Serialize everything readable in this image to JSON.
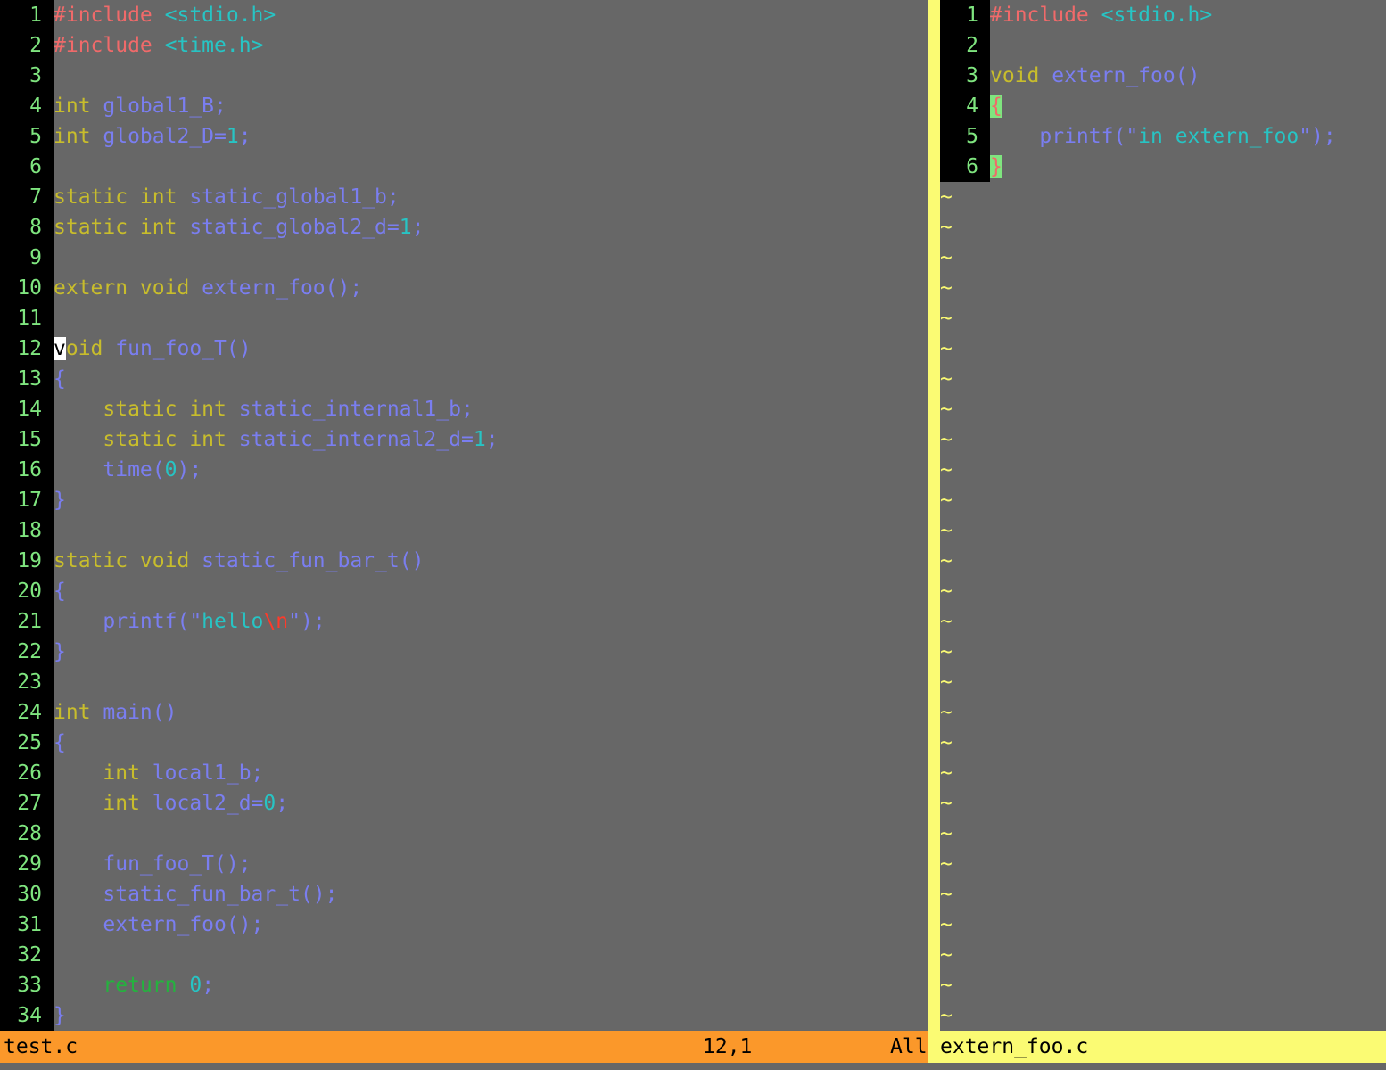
{
  "left_window": {
    "filename": "test.c",
    "position": "12,1",
    "scroll": "All",
    "lines": [
      {
        "n": "1",
        "tokens": [
          [
            "pre",
            "#include "
          ],
          [
            "inc",
            "<stdio.h>"
          ]
        ]
      },
      {
        "n": "2",
        "tokens": [
          [
            "pre",
            "#include "
          ],
          [
            "inc",
            "<time.h>"
          ]
        ]
      },
      {
        "n": "3",
        "tokens": []
      },
      {
        "n": "4",
        "tokens": [
          [
            "kw",
            "int "
          ],
          [
            "id",
            "global1_B;"
          ]
        ]
      },
      {
        "n": "5",
        "tokens": [
          [
            "kw",
            "int "
          ],
          [
            "id",
            "global2_D="
          ],
          [
            "num",
            "1"
          ],
          [
            "id",
            ";"
          ]
        ]
      },
      {
        "n": "6",
        "tokens": []
      },
      {
        "n": "7",
        "tokens": [
          [
            "kw",
            "static int "
          ],
          [
            "id",
            "static_global1_b;"
          ]
        ]
      },
      {
        "n": "8",
        "tokens": [
          [
            "kw",
            "static int "
          ],
          [
            "id",
            "static_global2_d="
          ],
          [
            "num",
            "1"
          ],
          [
            "id",
            ";"
          ]
        ]
      },
      {
        "n": "9",
        "tokens": []
      },
      {
        "n": "10",
        "tokens": [
          [
            "kw",
            "extern void "
          ],
          [
            "id",
            "extern_foo();"
          ]
        ]
      },
      {
        "n": "11",
        "tokens": []
      },
      {
        "n": "12",
        "tokens": [
          [
            "cursor",
            "v"
          ],
          [
            "kw",
            "oid "
          ],
          [
            "id",
            "fun_foo_T()"
          ]
        ]
      },
      {
        "n": "13",
        "tokens": [
          [
            "id",
            "{"
          ]
        ]
      },
      {
        "n": "14",
        "tokens": [
          [
            "kw",
            "    static int "
          ],
          [
            "id",
            "static_internal1_b;"
          ]
        ]
      },
      {
        "n": "15",
        "tokens": [
          [
            "kw",
            "    static int "
          ],
          [
            "id",
            "static_internal2_d="
          ],
          [
            "num",
            "1"
          ],
          [
            "id",
            ";"
          ]
        ]
      },
      {
        "n": "16",
        "tokens": [
          [
            "id",
            "    time("
          ],
          [
            "num",
            "0"
          ],
          [
            "id",
            ");"
          ]
        ]
      },
      {
        "n": "17",
        "tokens": [
          [
            "id",
            "}"
          ]
        ]
      },
      {
        "n": "18",
        "tokens": []
      },
      {
        "n": "19",
        "tokens": [
          [
            "kw",
            "static void "
          ],
          [
            "id",
            "static_fun_bar_t()"
          ]
        ]
      },
      {
        "n": "20",
        "tokens": [
          [
            "id",
            "{"
          ]
        ]
      },
      {
        "n": "21",
        "tokens": [
          [
            "id",
            "    printf(\""
          ],
          [
            "str",
            "hello"
          ],
          [
            "esc",
            "\\n"
          ],
          [
            "id",
            "\");"
          ]
        ]
      },
      {
        "n": "22",
        "tokens": [
          [
            "id",
            "}"
          ]
        ]
      },
      {
        "n": "23",
        "tokens": []
      },
      {
        "n": "24",
        "tokens": [
          [
            "kw",
            "int "
          ],
          [
            "id",
            "main()"
          ]
        ]
      },
      {
        "n": "25",
        "tokens": [
          [
            "id",
            "{"
          ]
        ]
      },
      {
        "n": "26",
        "tokens": [
          [
            "kw",
            "    int "
          ],
          [
            "id",
            "local1_b;"
          ]
        ]
      },
      {
        "n": "27",
        "tokens": [
          [
            "kw",
            "    int "
          ],
          [
            "id",
            "local2_d="
          ],
          [
            "num",
            "0"
          ],
          [
            "id",
            ";"
          ]
        ]
      },
      {
        "n": "28",
        "tokens": []
      },
      {
        "n": "29",
        "tokens": [
          [
            "id",
            "    fun_foo_T();"
          ]
        ]
      },
      {
        "n": "30",
        "tokens": [
          [
            "id",
            "    static_fun_bar_t();"
          ]
        ]
      },
      {
        "n": "31",
        "tokens": [
          [
            "id",
            "    extern_foo();"
          ]
        ]
      },
      {
        "n": "32",
        "tokens": []
      },
      {
        "n": "33",
        "tokens": [
          [
            "ret",
            "    return "
          ],
          [
            "num",
            "0"
          ],
          [
            "id",
            ";"
          ]
        ]
      },
      {
        "n": "34",
        "tokens": [
          [
            "id",
            "}"
          ]
        ]
      }
    ]
  },
  "right_window": {
    "filename": "extern_foo.c",
    "lines": [
      {
        "n": "1",
        "tokens": [
          [
            "pre",
            "#include "
          ],
          [
            "inc",
            "<stdio.h>"
          ]
        ]
      },
      {
        "n": "2",
        "tokens": []
      },
      {
        "n": "3",
        "tokens": [
          [
            "kw",
            "void "
          ],
          [
            "id",
            "extern_foo()"
          ]
        ]
      },
      {
        "n": "4",
        "tokens": [
          [
            "match",
            "{"
          ]
        ]
      },
      {
        "n": "5",
        "tokens": [
          [
            "id",
            "    printf(\""
          ],
          [
            "str",
            "in extern_foo"
          ],
          [
            "id",
            "\");"
          ]
        ]
      },
      {
        "n": "6",
        "tokens": [
          [
            "match",
            "}"
          ]
        ]
      }
    ],
    "empty_marker": "~",
    "empty_lines": 28
  },
  "colors": {
    "background": "#676767",
    "line_number": "#7fe57f",
    "preproc": "#f06a6a",
    "keyword": "#c8bd2c",
    "identifier": "#7a7ef0",
    "constant": "#27c4c4",
    "status_active": "#fb982a",
    "status_inactive": "#fbfb73"
  }
}
